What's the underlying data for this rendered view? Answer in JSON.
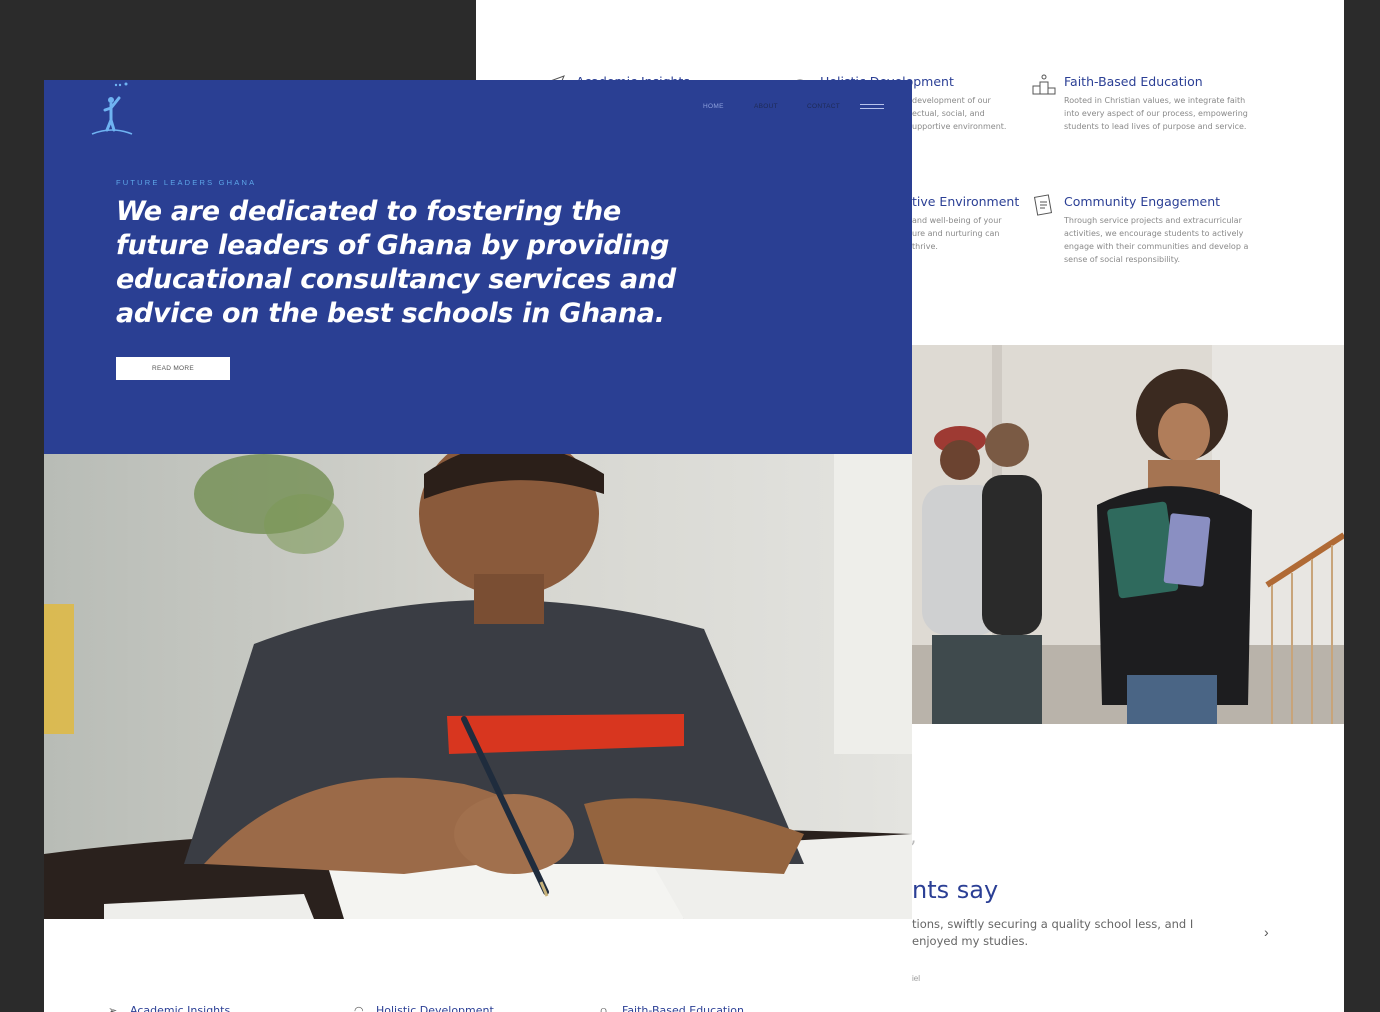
{
  "brand": "FUTURE LEADERS GHANA",
  "nav": {
    "home": "HOME",
    "about": "ABOUT",
    "contact": "CONTACT"
  },
  "hero": {
    "headline": "We are dedicated to fostering the future leaders of Ghana by providing educational consultancy services and advice on the best schools in Ghana.",
    "button": "READ MORE"
  },
  "features": [
    {
      "title": "Academic Insights",
      "icon": "paper-plane-icon"
    },
    {
      "title": "Holistic Development",
      "icon": "rainbow-icon",
      "desc_visible": "development of our ectual, social, and upportive environment."
    },
    {
      "title": "Faith-Based Education",
      "icon": "podium-icon",
      "desc": "Rooted in Christian values, we integrate faith into every aspect of our process, empowering students to lead lives of purpose and service."
    },
    {
      "title_visible": "tive Environment",
      "icon": "shield-icon",
      "desc_visible": "and well-being of your ure and nurturing can thrive."
    },
    {
      "title": "Community Engagement",
      "icon": "notebook-icon",
      "desc": "Through service projects and extracurricular activities, we encourage students to actively engage with their communities and develop a sense of social responsibility."
    }
  ],
  "testimonial": {
    "title_visible": "nts say",
    "text_visible": "tions, swiftly securing a quality school less, and I enjoyed my studies.",
    "author_visible": "iel",
    "next": "›"
  },
  "colors": {
    "brand_blue": "#2a3f93",
    "accent_light_blue": "#5da6e8",
    "title_blue": "#2b3f95"
  }
}
